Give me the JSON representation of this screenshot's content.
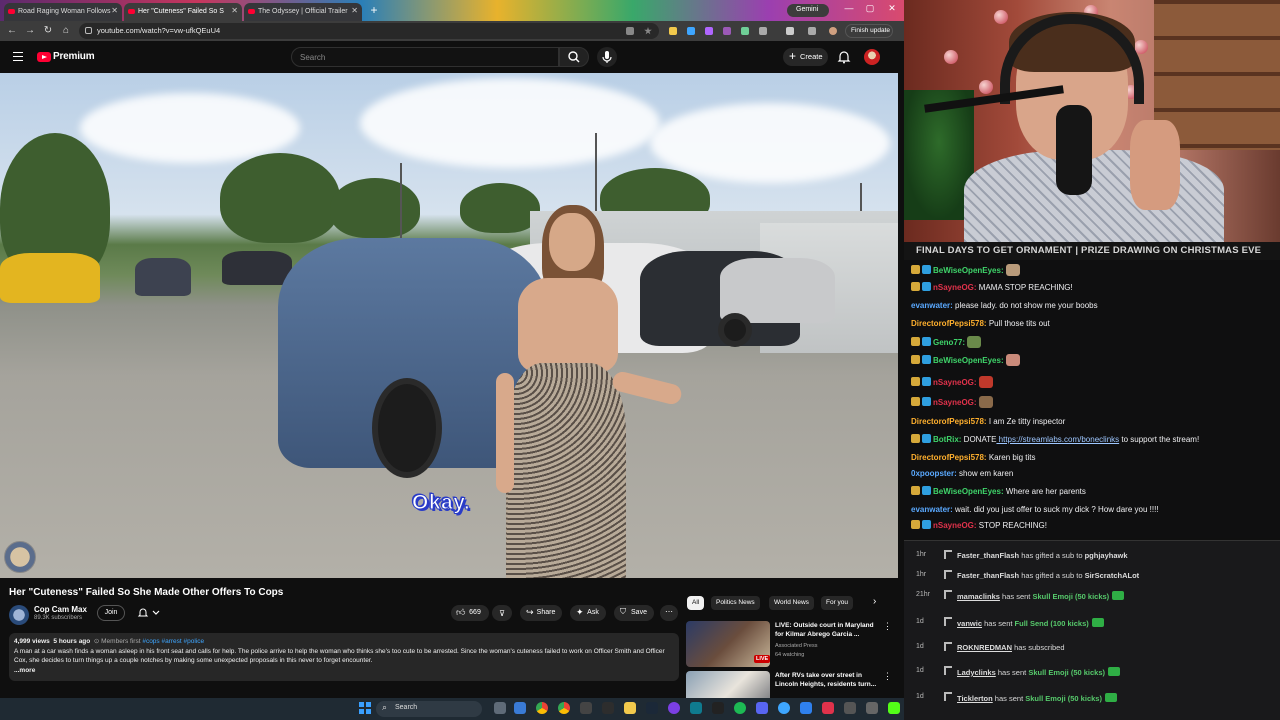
{
  "browser": {
    "tabs": [
      {
        "label": "Road Raging Woman Follows"
      },
      {
        "label": "Her \"Cuteness\" Failed So S"
      },
      {
        "label": "The Odyssey | Official Trailer"
      }
    ],
    "gemini_label": "Gemini",
    "url": "youtube.com/watch?v=vw-ufkQEuU4",
    "finish_update": "Finish update"
  },
  "youtube": {
    "brand": "Premium",
    "search_placeholder": "Search",
    "create_label": "Create",
    "video": {
      "caption": "Okay.",
      "title": "Her \"Cuteness\" Failed So She Made Other Offers To Cops"
    },
    "channel": {
      "name": "Cop Cam Max",
      "subscribers": "89.3K subscribers",
      "join_label": "Join"
    },
    "actions": {
      "likes": "669",
      "share": "Share",
      "ask": "Ask",
      "save": "Save"
    },
    "description": {
      "views": "4,999 views",
      "age": "5 hours ago",
      "members": "Members first",
      "tags": "#cops #arrest #police",
      "text": "A man at a car wash finds a woman asleep in his front seat and calls for help. The police arrive to help the woman who thinks she's too cute to be arrested. Since the woman's cuteness failed to work on Officer Smith and Officer Cox, she decides to turn things up a couple notches by making some unexpected proposals in this never to forget encounter.",
      "more": "...more"
    },
    "chips": [
      "All",
      "Politics News",
      "World News",
      "For you"
    ],
    "recommendations": [
      {
        "title": "LIVE: Outside court in Maryland for Kilmar Abrego Garcia ...",
        "channel": "Associated Press",
        "meta": "64 watching",
        "badge": "LIVE"
      },
      {
        "title": "After RVs take over street in Lincoln Heights, residents turn...",
        "channel": "",
        "meta": "",
        "badge": ""
      }
    ]
  },
  "taskbar": {
    "search_label": "Search"
  },
  "stream": {
    "ticker": "FINAL DAYS TO GET ORNAMENT | PRIZE DRAWING ON CHRISTMAS EVE",
    "chat": [
      {
        "user": "BeWiseOpenEyes:",
        "msg": "",
        "color": "#3fd46a",
        "badges": 2
      },
      {
        "user": "nSayneOG:",
        "msg": "MAMA STOP REACHING!",
        "color": "#e0324b",
        "badges": 2
      },
      {
        "user": "evanwater:",
        "msg": "please lady. do not show me your boobs",
        "color": "#5aa9ff",
        "badges": 0
      },
      {
        "user": "DirectorofPepsi578:",
        "msg": "Pull those tits out",
        "color": "#ffb02e",
        "badges": 0
      },
      {
        "user": "Geno77:",
        "msg": "",
        "color": "#3fd46a",
        "badges": 2
      },
      {
        "user": "BeWiseOpenEyes:",
        "msg": "",
        "color": "#3fd46a",
        "badges": 2
      },
      {
        "user": "nSayneOG:",
        "msg": "",
        "color": "#e0324b",
        "badges": 2
      },
      {
        "user": "nSayneOG:",
        "msg": "",
        "color": "#e0324b",
        "badges": 2
      },
      {
        "user": "DirectorofPepsi578:",
        "msg": "I am Ze titty inspector",
        "color": "#ffb02e",
        "badges": 0
      },
      {
        "user": "BotRix:",
        "msg": "DONATE",
        "link": "https://streamlabs.com/boneclinks",
        "after": "to support the stream!",
        "color": "#3fd46a",
        "badges": 2
      },
      {
        "user": "DirectorofPepsi578:",
        "msg": "Karen big tits",
        "color": "#ffb02e",
        "badges": 0
      },
      {
        "user": "0xpoopster:",
        "msg": "show em karen",
        "color": "#5aa9ff",
        "badges": 0
      },
      {
        "user": "BeWiseOpenEyes:",
        "msg": "Where are her parents",
        "color": "#3fd46a",
        "badges": 2
      },
      {
        "user": "evanwater:",
        "msg": "wait. did you just offer to suck my dick ? How dare you !!!!",
        "color": "#5aa9ff",
        "badges": 0
      },
      {
        "user": "nSayneOG:",
        "msg": "STOP REACHING!",
        "color": "#e0324b",
        "badges": 2
      }
    ],
    "events": [
      {
        "time": "1hr",
        "user": "Faster_thanFlash",
        "text": "has gifted a sub to",
        "target": "pghjayhawk"
      },
      {
        "time": "1hr",
        "user": "Faster_thanFlash",
        "text": "has gifted a sub to",
        "target": "SirScratchALot"
      },
      {
        "time": "21hr",
        "user": "mamaclinks",
        "text": "has sent",
        "item": "Skull Emoji (50 kicks)",
        "gift": true
      },
      {
        "time": "1d",
        "user": "vanwic",
        "text": "has sent",
        "item": "Full Send (100 kicks)",
        "gift": true
      },
      {
        "time": "1d",
        "user": "ROKNREDMAN",
        "text": "has subscribed",
        "item": ""
      },
      {
        "time": "1d",
        "user": "Ladyclinks",
        "text": "has sent",
        "item": "Skull Emoji (50 kicks)",
        "gift": true
      },
      {
        "time": "1d",
        "user": "Ticklerton",
        "text": "has sent",
        "item": "Skull Emoji (50 kicks)",
        "gift": true
      }
    ]
  },
  "colors": {
    "yt_red": "#ff0033",
    "link_blue": "#3ea6ff",
    "kick_green": "#56c96b"
  }
}
